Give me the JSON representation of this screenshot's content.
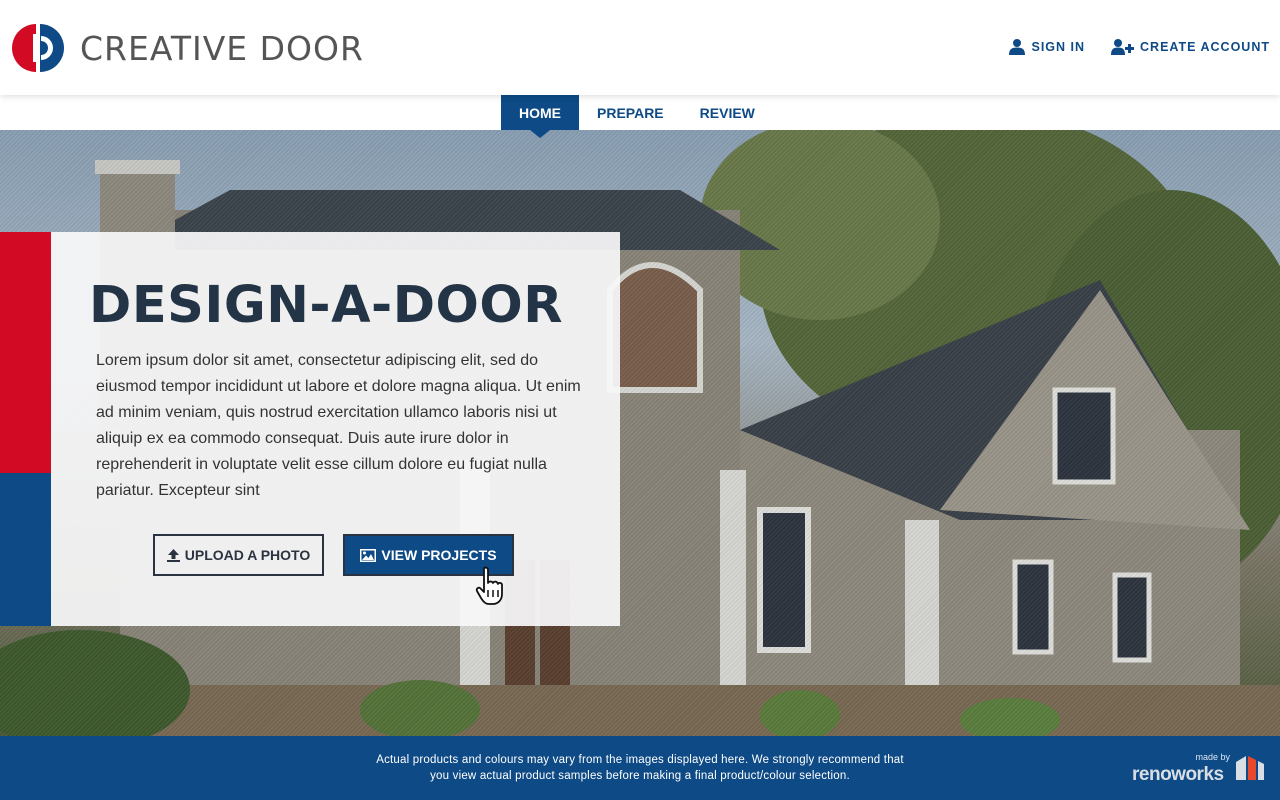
{
  "header": {
    "logo_text": "CREATIVE DOOR",
    "sign_in": "SIGN IN",
    "create_account": "CREATE ACCOUNT"
  },
  "tabs": [
    {
      "label": "HOME",
      "active": true
    },
    {
      "label": "PREPARE",
      "active": false
    },
    {
      "label": "REVIEW",
      "active": false
    }
  ],
  "hero": {
    "title": "DESIGN-A-DOOR",
    "body": "Lorem ipsum dolor sit amet, consectetur adipiscing elit, sed do eiusmod tempor incididunt ut labore et dolore magna aliqua. Ut enim ad minim veniam, quis nostrud exercitation ullamco laboris nisi ut aliquip ex ea commodo consequat. Duis aute irure dolor in reprehenderit in voluptate velit esse cillum dolore eu fugiat nulla pariatur. Excepteur sint",
    "upload_button": "UPLOAD A PHOTO",
    "view_button": "VIEW PROJECTS"
  },
  "footer": {
    "disclaimer_line1": "Actual products and colours may vary from the images displayed here. We strongly recommend that",
    "disclaimer_line2": "you view actual product samples before making a final product/colour selection.",
    "made_by": "made by",
    "brand_name": "renoworks"
  },
  "colors": {
    "brand_blue": "#0d4a86",
    "brand_red": "#d20a24",
    "title_dark": "#233446"
  },
  "icons": {
    "sign_in": "user-icon",
    "create_account": "user-plus-icon",
    "upload": "upload-icon",
    "view": "image-icon",
    "cursor": "hand-pointer-icon"
  }
}
